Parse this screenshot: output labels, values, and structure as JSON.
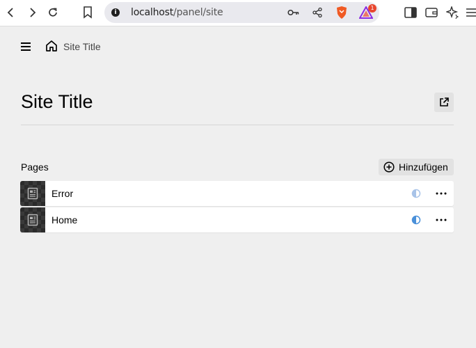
{
  "browser": {
    "url_host": "localhost",
    "url_path": "/panel/site",
    "notification_count": "1"
  },
  "header": {
    "breadcrumb_label": "Site Title"
  },
  "main": {
    "title": "Site Title",
    "section_label": "Pages",
    "add_label": "Hinzufügen",
    "pages": [
      {
        "title": "Error",
        "status": "unlisted",
        "status_color": "#a8c3e8"
      },
      {
        "title": "Home",
        "status": "listed",
        "status_color": "#4a90d9"
      }
    ]
  },
  "colors": {
    "background": "#efefef",
    "row_background": "#ffffff",
    "button_background": "#e2e2e2"
  }
}
